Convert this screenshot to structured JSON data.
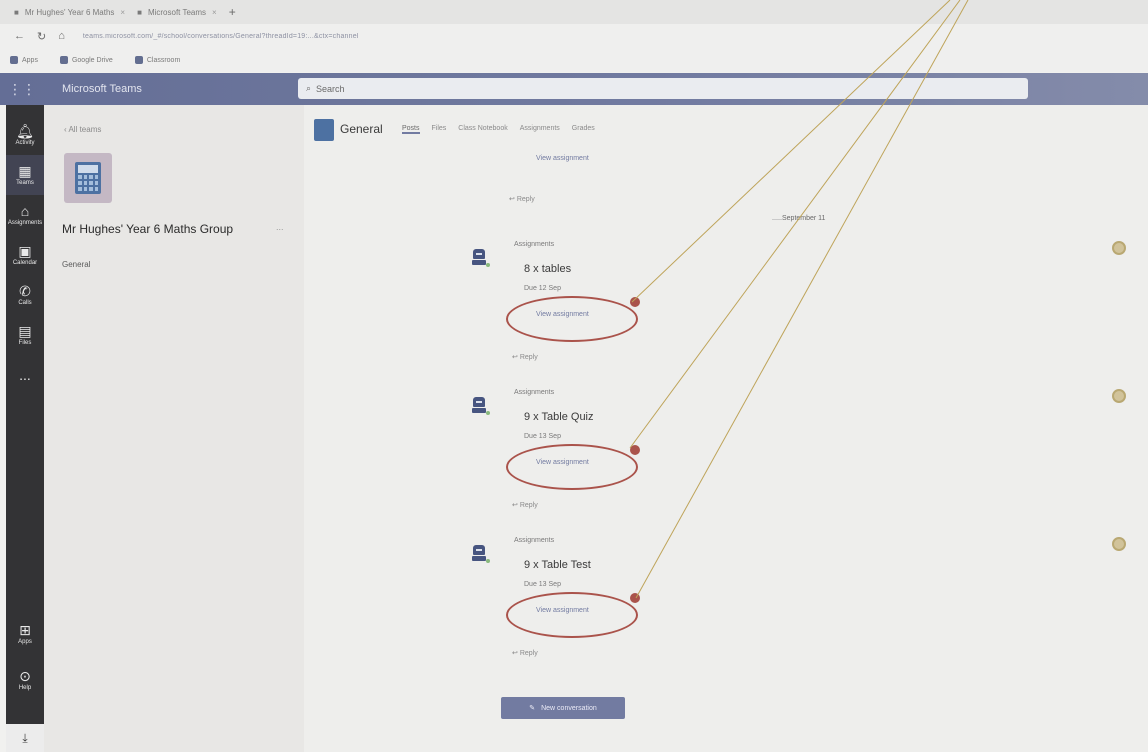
{
  "browser": {
    "tabs": [
      {
        "label": "Mr Hughes' Year 6 Maths"
      },
      {
        "label": "Microsoft Teams"
      }
    ],
    "url": "teams.microsoft.com/_#/school/conversations/General?threadId=19:...&ctx=channel",
    "bookmarks": [
      "Apps",
      "Google Drive",
      "Classroom"
    ]
  },
  "teams": {
    "app_title": "Microsoft Teams",
    "search_placeholder": "Search"
  },
  "rail": {
    "items": [
      {
        "label": "Activity",
        "icon": "bell-icon"
      },
      {
        "label": "Teams",
        "icon": "teams-icon"
      },
      {
        "label": "Assignments",
        "icon": "assignments-icon"
      },
      {
        "label": "Calendar",
        "icon": "calendar-icon"
      },
      {
        "label": "Calls",
        "icon": "phone-icon"
      },
      {
        "label": "Files",
        "icon": "files-icon"
      },
      {
        "label": "...",
        "icon": "more-icon"
      }
    ],
    "bottom": [
      {
        "label": "Apps",
        "icon": "apps-icon"
      },
      {
        "label": "Help",
        "icon": "help-icon"
      }
    ]
  },
  "team": {
    "back_label": "All teams",
    "name": "Mr Hughes' Year 6 Maths Group",
    "more": "...",
    "channel": "General"
  },
  "channel": {
    "title": "General",
    "tabs": [
      "Posts",
      "Files",
      "Class Notebook",
      "Assignments",
      "Grades"
    ],
    "view_assignment_top": "View assignment",
    "reply_top": "Reply",
    "date_divider": "September 11"
  },
  "posts": [
    {
      "meta": "Assignments",
      "title": "8 x tables",
      "sub": "Due 12 Sep",
      "view": "View assignment",
      "reply": "Reply"
    },
    {
      "meta": "Assignments",
      "title": "9 x Table Quiz",
      "sub": "Due 13 Sep",
      "view": "View assignment",
      "reply": "Reply"
    },
    {
      "meta": "Assignments",
      "title": "9 x Table Test",
      "sub": "Due 13 Sep",
      "view": "View assignment",
      "reply": "Reply"
    }
  ],
  "new_conversation": "New conversation",
  "colors": {
    "accent": "#6b78ad",
    "annotation": "#c2473b",
    "rail": "#2b2b2e"
  }
}
